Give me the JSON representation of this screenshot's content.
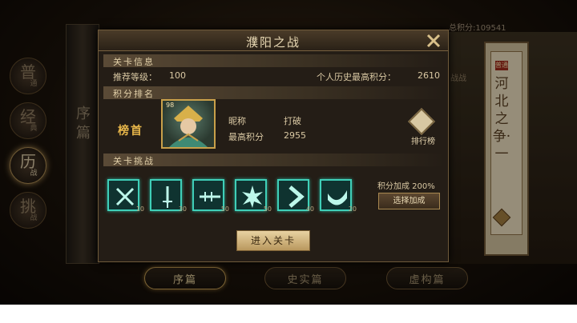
{
  "background": {
    "mode_tabs": [
      {
        "big": "普",
        "small": "通"
      },
      {
        "big": "经",
        "small": "典"
      },
      {
        "big": "历",
        "small": "战"
      },
      {
        "big": "挑",
        "small": "战"
      }
    ],
    "scroll_text": "序篇",
    "score_readout": "总积分:109541",
    "side_label": "战战",
    "right_card": {
      "seal": "普通",
      "title": "河北之争·一"
    },
    "bottom_tabs": [
      "序篇",
      "史实篇",
      "虚构篇"
    ]
  },
  "modal": {
    "title": "濮阳之战",
    "level_info": {
      "section_label": "关卡信息",
      "recommended_level_label": "推荐等级：",
      "recommended_level": "100",
      "history_high_label": "个人历史最高积分：",
      "history_high": "2610"
    },
    "ranking": {
      "section_label": "积分排名",
      "rank_label": "榜首",
      "portrait_level": "98",
      "nickname_label": "昵称",
      "nickname": "打破",
      "high_score_label": "最高积分",
      "high_score": "2955",
      "rank_list_button": "排行榜"
    },
    "challenge": {
      "section_label": "关卡挑战",
      "skills": [
        {
          "icon": "crossed-swords-icon",
          "value": "10"
        },
        {
          "icon": "sword-icon",
          "value": "30"
        },
        {
          "icon": "lance-icon",
          "value": "50"
        },
        {
          "icon": "burst-icon",
          "value": "50"
        },
        {
          "icon": "chevron-right-icon",
          "value": "40"
        },
        {
          "icon": "horn-icon",
          "value": "20"
        }
      ],
      "bonus_text": "积分加成 200%",
      "select_bonus_button": "选择加成"
    },
    "enter_button": "进入关卡"
  }
}
